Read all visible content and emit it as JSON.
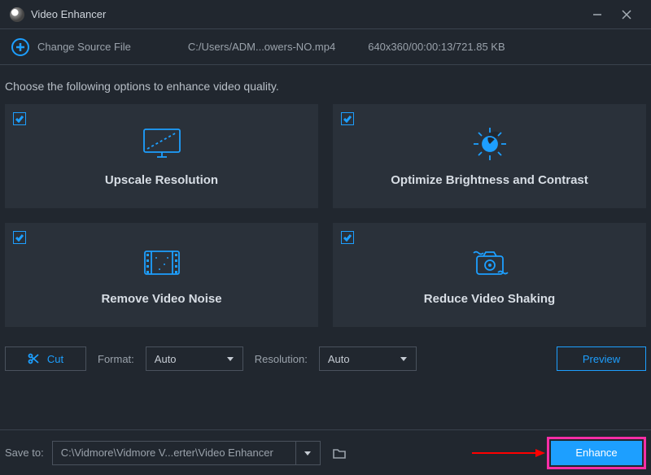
{
  "title": "Video Enhancer",
  "source": {
    "change_label": "Change Source File",
    "path": "C:/Users/ADM...owers-NO.mp4",
    "meta": "640x360/00:00:13/721.85 KB"
  },
  "instruction": "Choose the following options to enhance video quality.",
  "cards": {
    "upscale": "Upscale Resolution",
    "brightness": "Optimize Brightness and Contrast",
    "noise": "Remove Video Noise",
    "shaking": "Reduce Video Shaking"
  },
  "controls": {
    "cut_label": "Cut",
    "format_label": "Format:",
    "format_value": "Auto",
    "resolution_label": "Resolution:",
    "resolution_value": "Auto",
    "preview_label": "Preview"
  },
  "bottom": {
    "save_label": "Save to:",
    "save_path": "C:\\Vidmore\\Vidmore V...erter\\Video Enhancer",
    "enhance_label": "Enhance"
  }
}
